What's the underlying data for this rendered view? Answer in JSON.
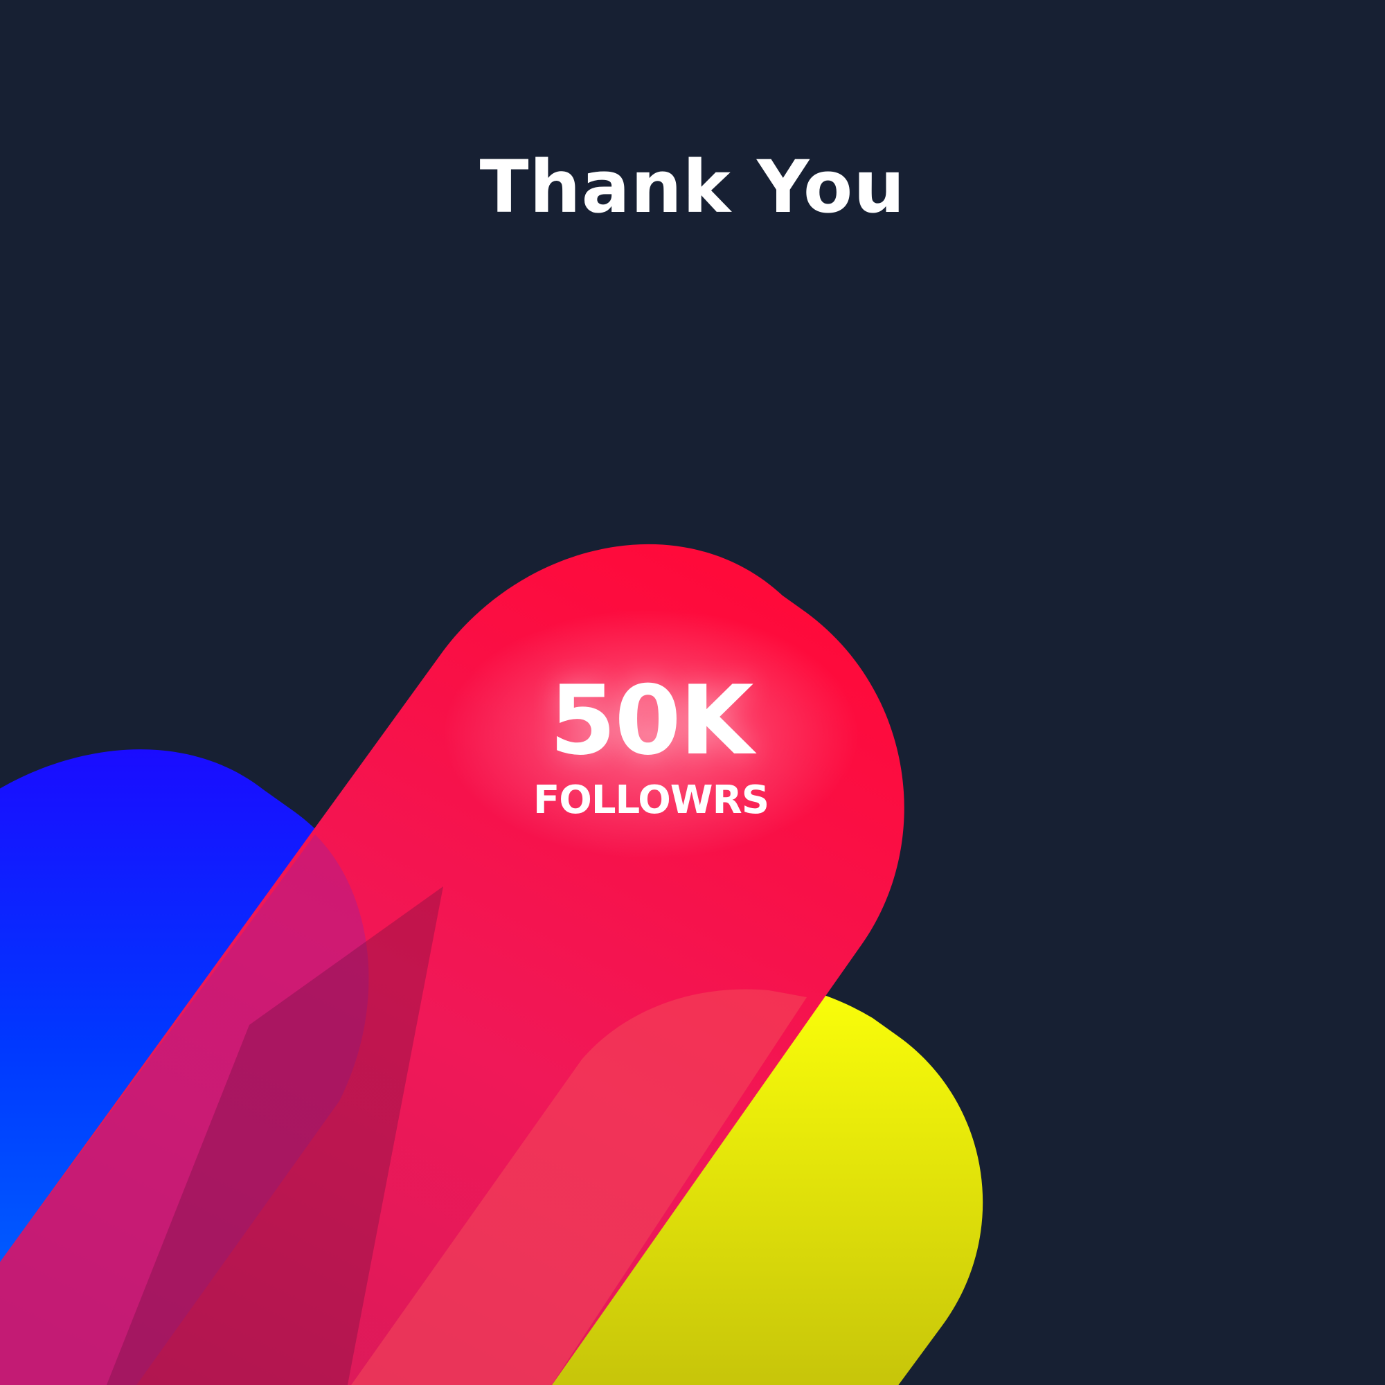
{
  "title": "Thank You",
  "milestone": {
    "number": "50K",
    "label": "FOLLOWRS"
  },
  "colors": {
    "background": "#172033",
    "blue_top": "#1a0cff",
    "blue_bottom": "#0066ff",
    "red_top": "#ff0a3a",
    "red_bottom": "#8a1a4a",
    "yellow_top": "#fbff0a",
    "yellow_bottom": "#c9c90a",
    "text": "#ffffff"
  },
  "decor": {
    "shapes": [
      "blue-ribbon",
      "yellow-ribbon",
      "red-ribbon"
    ]
  }
}
